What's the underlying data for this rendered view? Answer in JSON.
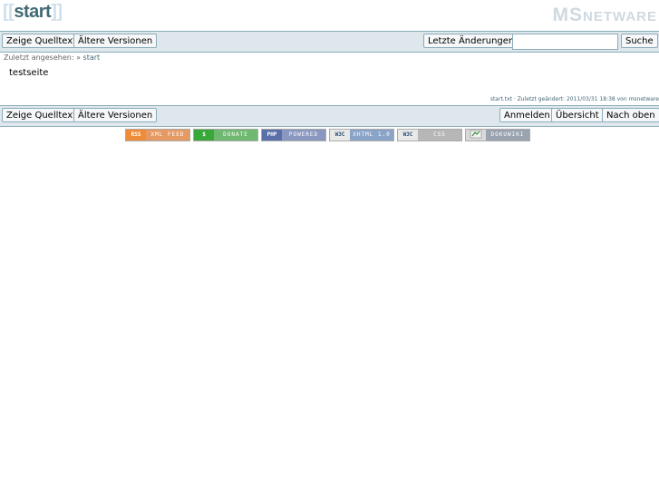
{
  "header": {
    "bracket_open": "[[",
    "page_name": "start",
    "bracket_close": "]]",
    "logo_big": "MS",
    "logo_small": "NETWARE"
  },
  "top_bar": {
    "show_source": "Zeige Quelltext",
    "old_versions": "Ältere Versionen",
    "recent_changes": "Letzte Änderungen",
    "search_value": "",
    "search_button": "Suche"
  },
  "breadcrumbs": {
    "label": "Zuletzt angesehen:",
    "separator": "»",
    "item": "start"
  },
  "content": {
    "text": "testseite"
  },
  "meta": {
    "text": "start.txt · Zuletzt geändert: 2011/03/31 18:38 von msnetware"
  },
  "bottom_bar": {
    "show_source": "Zeige Quelltext",
    "old_versions": "Ältere Versionen",
    "login": "Anmelden",
    "index": "Übersicht",
    "to_top": "Nach oben"
  },
  "badges": [
    {
      "left": "RSS",
      "right": "XML FEED",
      "left_color": "#f08b38",
      "right_color": "#e59a63"
    },
    {
      "left": "$",
      "right": "DONATE",
      "left_color": "#38a83a",
      "right_color": "#6fb870"
    },
    {
      "left": "PHP",
      "right": "POWERED",
      "left_color": "#5a6fa8",
      "right_color": "#8a97c0"
    },
    {
      "left": "W3C",
      "right": "XHTML 1.0",
      "left_color": "#e8e8e8",
      "right_color": "#8aa4c8"
    },
    {
      "left": "W3C",
      "right": "CSS",
      "left_color": "#e8e8e8",
      "right_color": "#b7b7b7"
    },
    {
      "left": "DW",
      "right": "DOKUWIKI",
      "left_color": "#d9d9d9",
      "right_color": "#9aa3b0"
    }
  ]
}
